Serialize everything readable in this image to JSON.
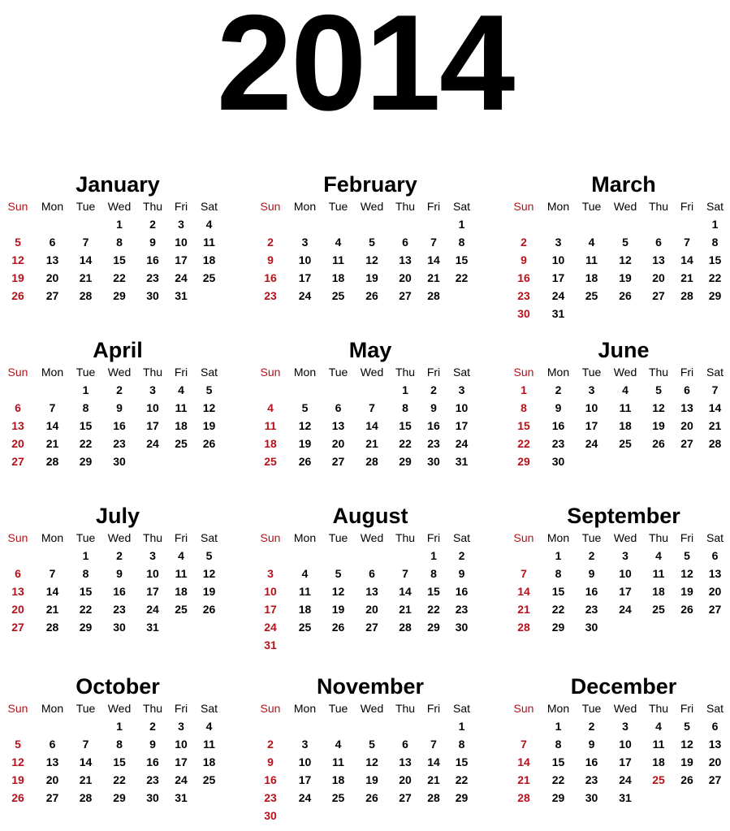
{
  "year": "2014",
  "weekdays": [
    "Sun",
    "Mon",
    "Tue",
    "Wed",
    "Thu",
    "Fri",
    "Sat"
  ],
  "colors": {
    "sunday": "#b5121b",
    "text": "#000000"
  },
  "months": [
    {
      "name": "January",
      "start": 3,
      "days": 31,
      "holidays": []
    },
    {
      "name": "February",
      "start": 6,
      "days": 28,
      "holidays": []
    },
    {
      "name": "March",
      "start": 6,
      "days": 31,
      "holidays": []
    },
    {
      "name": "April",
      "start": 2,
      "days": 30,
      "holidays": []
    },
    {
      "name": "May",
      "start": 4,
      "days": 31,
      "holidays": []
    },
    {
      "name": "June",
      "start": 0,
      "days": 30,
      "holidays": []
    },
    {
      "name": "July",
      "start": 2,
      "days": 31,
      "holidays": []
    },
    {
      "name": "August",
      "start": 5,
      "days": 31,
      "holidays": []
    },
    {
      "name": "September",
      "start": 1,
      "days": 30,
      "holidays": []
    },
    {
      "name": "October",
      "start": 3,
      "days": 31,
      "holidays": []
    },
    {
      "name": "November",
      "start": 6,
      "days": 30,
      "holidays": []
    },
    {
      "name": "December",
      "start": 1,
      "days": 31,
      "holidays": [
        25
      ]
    }
  ]
}
